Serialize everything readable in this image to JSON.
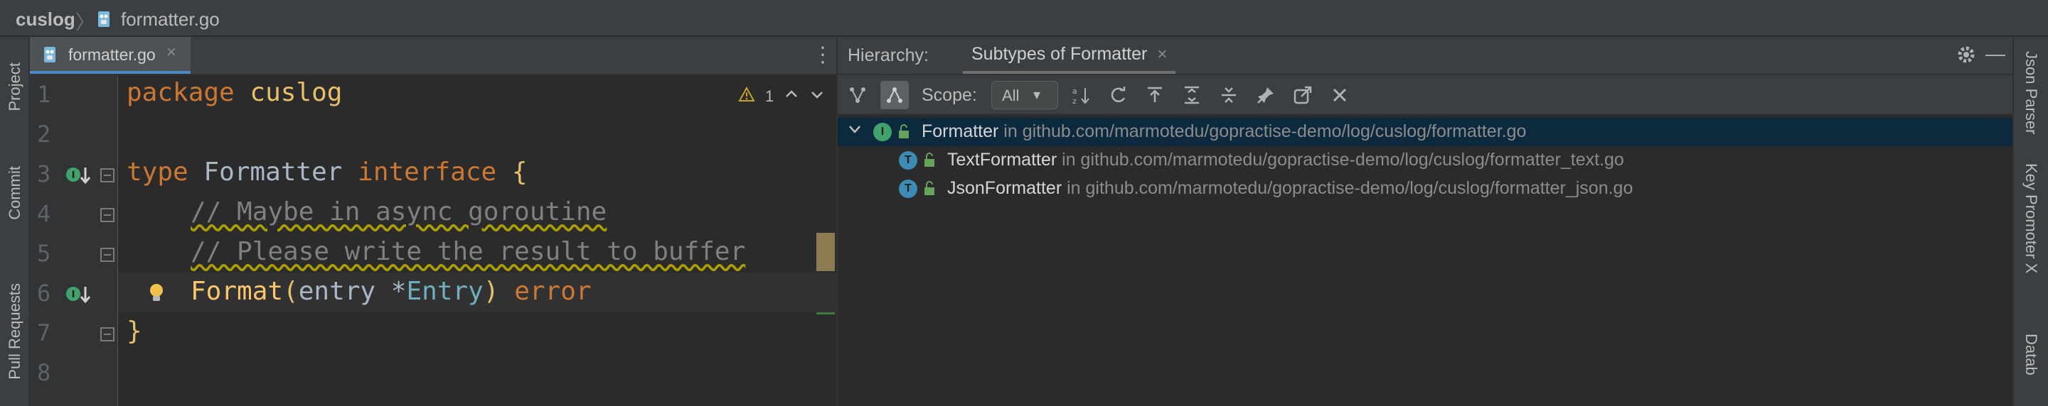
{
  "navbar": {
    "project": "cuslog",
    "separator": "〉",
    "file": "formatter.go"
  },
  "left_strip": {
    "tabs": [
      "Project",
      "Commit",
      "Pull Requests"
    ]
  },
  "right_strip": {
    "tabs": [
      "Json Parser",
      "Key Promoter X",
      "Datab"
    ]
  },
  "editor": {
    "tab_label": "formatter.go",
    "tab_close": "×",
    "menu": "⋮",
    "inspection": {
      "warning_count": "1"
    },
    "line_numbers": [
      "1",
      "2",
      "3",
      "4",
      "5",
      "6",
      "7",
      "8"
    ],
    "lines": {
      "l1": {
        "kw": "package",
        "name": "cuslog"
      },
      "l3": {
        "kw": "type",
        "name": "Formatter",
        "kw2": "interface",
        "brace": "{"
      },
      "l4": {
        "comment": "// Maybe in async goroutine"
      },
      "l5": {
        "comment": "// Please write the result to buffer"
      },
      "l6": {
        "fn": "Format",
        "open": "(",
        "arg": "entry ",
        "star": "*",
        "type": "Entry",
        "close": ")",
        "ret": " error"
      },
      "l7": {
        "brace": "}"
      }
    }
  },
  "hierarchy": {
    "title": "Hierarchy:",
    "tab": "Subtypes of Formatter",
    "tab_close": "×",
    "minimize": "—",
    "scope_label": "Scope:",
    "scope_value": "All",
    "tree": [
      {
        "badge": "I",
        "name": "Formatter",
        "location": " in github.com/marmotedu/gopractise-demo/log/cuslog/formatter.go"
      },
      {
        "badge": "T",
        "name": "TextFormatter",
        "location": " in github.com/marmotedu/gopractise-demo/log/cuslog/formatter_text.go"
      },
      {
        "badge": "T",
        "name": "JsonFormatter",
        "location": " in github.com/marmotedu/gopractise-demo/log/cuslog/formatter_json.go"
      }
    ]
  },
  "colors": {
    "accent": "#4a88c7",
    "selection": "#0d293e",
    "interface_badge": "#40a36b",
    "class_badge": "#3b8bb4"
  },
  "icons": [
    "go-file-icon",
    "project-icon",
    "commit-icon",
    "pull-request-icon",
    "gear-icon",
    "warning-icon",
    "bulb-icon",
    "implemented-icon",
    "lock-icon"
  ]
}
